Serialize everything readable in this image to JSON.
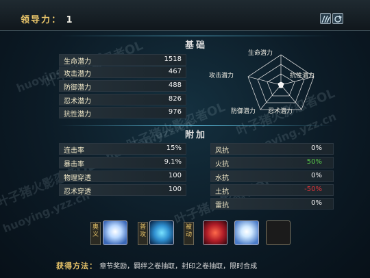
{
  "header": {
    "leadership_label": "领导力：",
    "leadership_value": "1"
  },
  "base": {
    "title": "基础",
    "rows": [
      {
        "label": "生命潜力",
        "value": "1518"
      },
      {
        "label": "攻击潜力",
        "value": "467"
      },
      {
        "label": "防御潜力",
        "value": "488"
      },
      {
        "label": "忍术潜力",
        "value": "826"
      },
      {
        "label": "抗性潜力",
        "value": "976"
      }
    ],
    "radar_labels": {
      "top": "生命潜力",
      "left": "攻击潜力",
      "right": "抗性潜力",
      "bottom_left": "防御潜力",
      "bottom_right": "忍术潜力"
    }
  },
  "extra": {
    "title": "附加",
    "left_rows": [
      {
        "label": "连击率",
        "value": "15%"
      },
      {
        "label": "暴击率",
        "value": "9.1%"
      },
      {
        "label": "物理穿透",
        "value": "100"
      },
      {
        "label": "忍术穿透",
        "value": "100"
      }
    ],
    "right_rows": [
      {
        "label": "风抗",
        "value": "0%"
      },
      {
        "label": "火抗",
        "value": "50%",
        "color": "#58c74a"
      },
      {
        "label": "水抗",
        "value": "0%"
      },
      {
        "label": "土抗",
        "value": "-50%",
        "color": "#e0353a"
      },
      {
        "label": "雷抗",
        "value": "0%"
      }
    ]
  },
  "skills": {
    "tags": [
      {
        "label": "奥义"
      },
      {
        "label": "普攻"
      },
      {
        "label": "被动"
      }
    ],
    "icons": [
      "ice-shard-skill-icon",
      "fist-punch-skill-icon",
      "red-ninja-skill-icon",
      "crystal-burst-skill-icon",
      "empty-skill-slot"
    ]
  },
  "footer": {
    "label": "获得方法：",
    "text": "章节奖励，羁绊之卷抽取，封印之卷抽取，限时合成"
  },
  "watermark": {
    "text": "叶子猪火影忍者OL",
    "url": "huoying.yzz.cn"
  }
}
